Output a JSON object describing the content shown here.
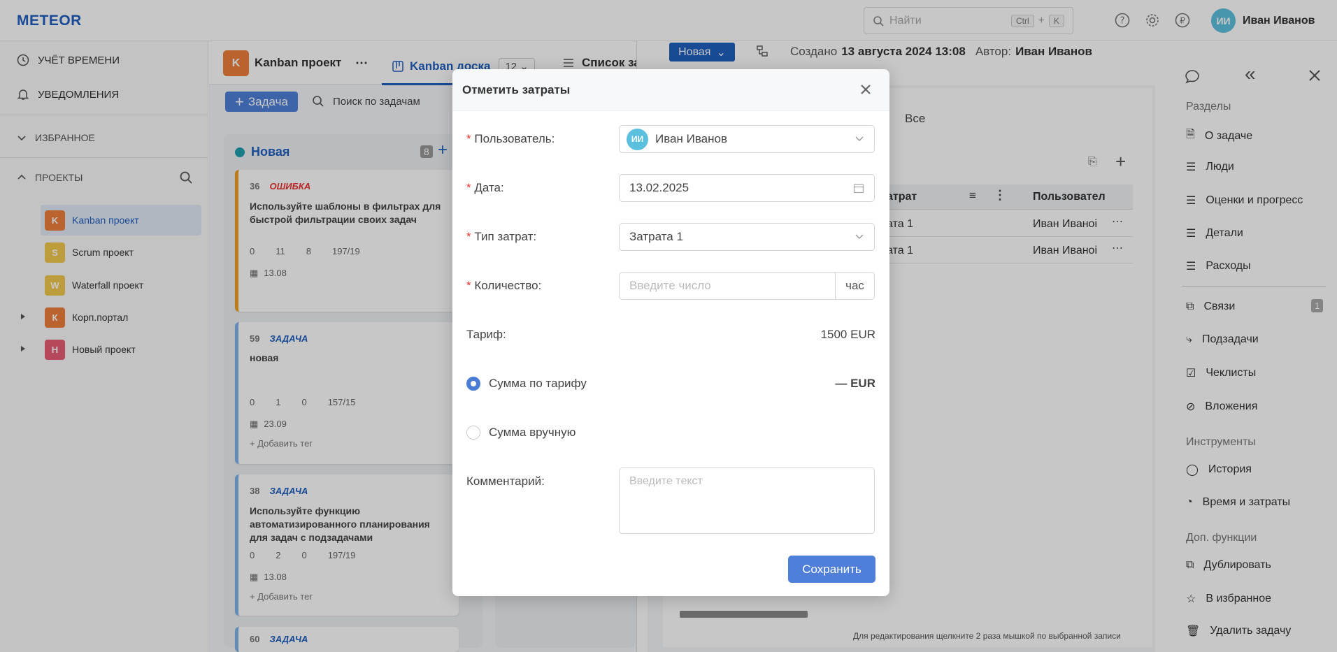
{
  "app": {
    "logo": "METEOR"
  },
  "topbar": {
    "search_placeholder": "Найти",
    "kbd_ctrl": "Ctrl",
    "kbd_plus": "+",
    "kbd_k": "K",
    "user_initials": "ИИ",
    "user_name": "Иван Иванов"
  },
  "sidebar": {
    "time_tracking": "УЧЁТ ВРЕМЕНИ",
    "notifications": "УВЕДОМЛЕНИЯ",
    "favorites": "ИЗБРАННОЕ",
    "projects": "ПРОЕКТЫ",
    "project_list": [
      {
        "letter": "K",
        "name": "Kanban проект",
        "color": "#f07f3c"
      },
      {
        "letter": "S",
        "name": "Scrum проект",
        "color": "#f2c94c"
      },
      {
        "letter": "W",
        "name": "Waterfall проект",
        "color": "#f2c94c"
      },
      {
        "letter": "К",
        "name": "Корп.портал",
        "color": "#f07f3c"
      },
      {
        "letter": "Н",
        "name": "Новый проект",
        "color": "#e85d75"
      }
    ]
  },
  "board": {
    "project_letter": "K",
    "project_name": "Kanban проект",
    "tab_kanban": "Kanban доска",
    "tab_count": "12",
    "tab_list": "Список за",
    "add_task": "Задача",
    "search_tasks": "Поиск по задачам",
    "column_name": "Новая",
    "column_count": "8",
    "cards": [
      {
        "id": "36",
        "type": "ОШИБКА",
        "title": "Используйте шаблоны в фильтрах для быстрой фильтрации своих задач",
        "subtasks": "0",
        "comments": "11",
        "time": "8",
        "progress": "197/19",
        "date": "13.08",
        "tag": ""
      },
      {
        "id": "59",
        "type": "ЗАДАЧА",
        "title": "новая",
        "subtasks": "0",
        "comments": "1",
        "time": "0",
        "progress": "157/15",
        "date": "23.09",
        "tag": "+ Добавить тег"
      },
      {
        "id": "38",
        "type": "ЗАДАЧА",
        "title": "Используйте функцию автоматизированного планирования для задач с подзадачами",
        "subtasks": "0",
        "comments": "2",
        "time": "0",
        "progress": "197/19",
        "date": "13.08",
        "tag": "+ Добавить тег"
      }
    ],
    "partial_card": {
      "id": "60",
      "type": "ЗАДАЧА"
    }
  },
  "task": {
    "status": "Новая",
    "created_label": "Создано",
    "created_date": "13 августа 2024 13:08",
    "author_label": "Автор:",
    "author": "Иван Иванов",
    "filter_all": "Все",
    "col_type": "атрат",
    "col_user": "Пользовател",
    "rows": [
      {
        "type": "ата 1",
        "user": "Иван Иваноі"
      },
      {
        "type": "ата 1",
        "user": "Иван Иваноі"
      }
    ],
    "hint": "Для редактирования щелкните 2 раза мышкой по выбранной записи"
  },
  "rightnav": {
    "sections_title": "Разделы",
    "sections": [
      "О задаче",
      "Люди",
      "Оценки и прогресс",
      "Детали",
      "Расходы"
    ],
    "links": "Связи",
    "links_count": "1",
    "subtasks": "Подзадачи",
    "checklists": "Чеклисты",
    "attachments": "Вложения",
    "tools_title": "Инструменты",
    "history": "История",
    "time_costs": "Время и затраты",
    "extra_title": "Доп. функции",
    "duplicate": "Дублировать",
    "favorite": "В избранное",
    "delete": "Удалить задачу"
  },
  "dialog": {
    "title": "Отметить затраты",
    "user_label": "Пользователь",
    "user_initials": "ИИ",
    "user_value": "Иван Иванов",
    "date_label": "Дата",
    "date_value": "13.02.2025",
    "cost_type_label": "Тип затрат",
    "cost_type_value": "Затрата 1",
    "quantity_label": "Количество",
    "quantity_placeholder": "Введите число",
    "quantity_unit": "час",
    "rate_label": "Тариф",
    "rate_value": "1500 EUR",
    "sum_by_rate": "Сумма по тарифу",
    "sum_by_rate_value": "— EUR",
    "sum_manual": "Сумма вручную",
    "comment_label": "Комментарий",
    "comment_placeholder": "Введите текст",
    "save": "Сохранить"
  },
  "colors": {
    "accent": "#4f7fd8",
    "logo": "#1f5fbf",
    "error": "#e33",
    "task_type": "#1f5fbf",
    "avatar": "#5bc0de"
  }
}
